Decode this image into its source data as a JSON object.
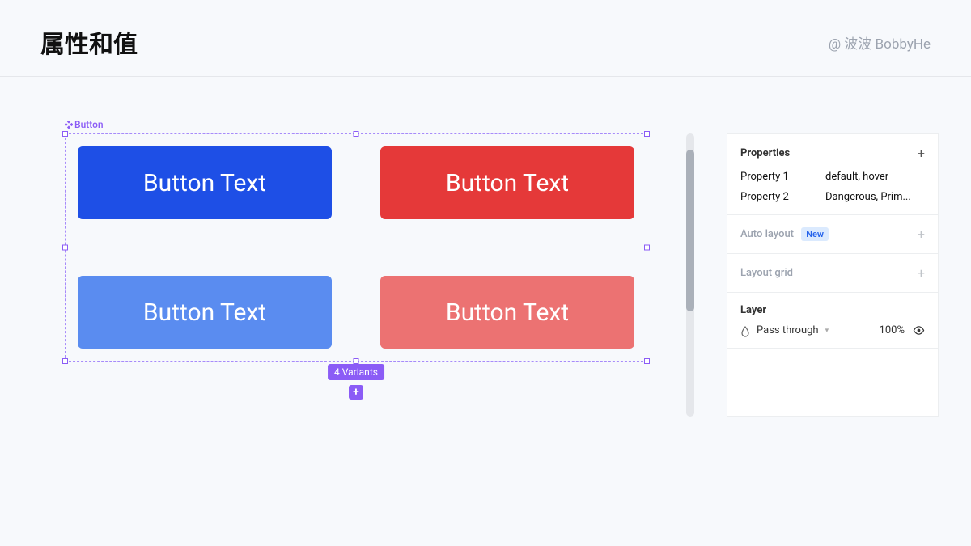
{
  "header": {
    "title": "属性和值",
    "author": "@ 波波 BobbyHe"
  },
  "canvas": {
    "component_label": "Button",
    "variants_badge": "4 Variants",
    "buttons": [
      {
        "label": "Button Text"
      },
      {
        "label": "Button Text"
      },
      {
        "label": "Button Text"
      },
      {
        "label": "Button Text"
      }
    ]
  },
  "inspector": {
    "properties": {
      "header": "Properties",
      "rows": [
        {
          "name": "Property 1",
          "value": "default, hover"
        },
        {
          "name": "Property 2",
          "value": "Dangerous, Prim..."
        }
      ]
    },
    "auto_layout": {
      "label": "Auto layout",
      "badge": "New"
    },
    "layout_grid": {
      "label": "Layout grid"
    },
    "layer": {
      "header": "Layer",
      "blend_mode": "Pass through",
      "opacity": "100%"
    }
  }
}
